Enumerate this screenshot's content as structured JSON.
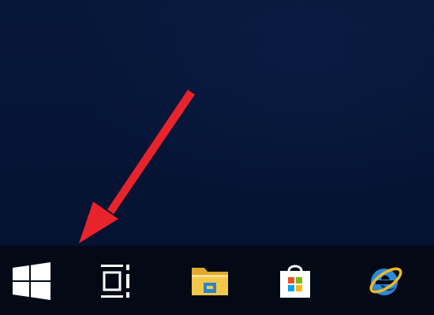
{
  "desktop": {
    "background_color": "#061638",
    "annotation_arrow_color": "#e8232b",
    "annotation_target": "start-button"
  },
  "taskbar": {
    "background_color": "#030a16",
    "items": [
      {
        "id": "start",
        "icon": "windows-logo-icon",
        "color": "#ffffff"
      },
      {
        "id": "task-view",
        "icon": "task-view-icon",
        "color": "#ffffff"
      },
      {
        "id": "file-explorer",
        "icon": "folder-icon",
        "color": "#f5c84c"
      },
      {
        "id": "microsoft-store",
        "icon": "store-bag-icon",
        "color": "#ffffff"
      },
      {
        "id": "internet-explorer",
        "icon": "internet-explorer-icon",
        "color": "#2a8ad9"
      }
    ]
  }
}
